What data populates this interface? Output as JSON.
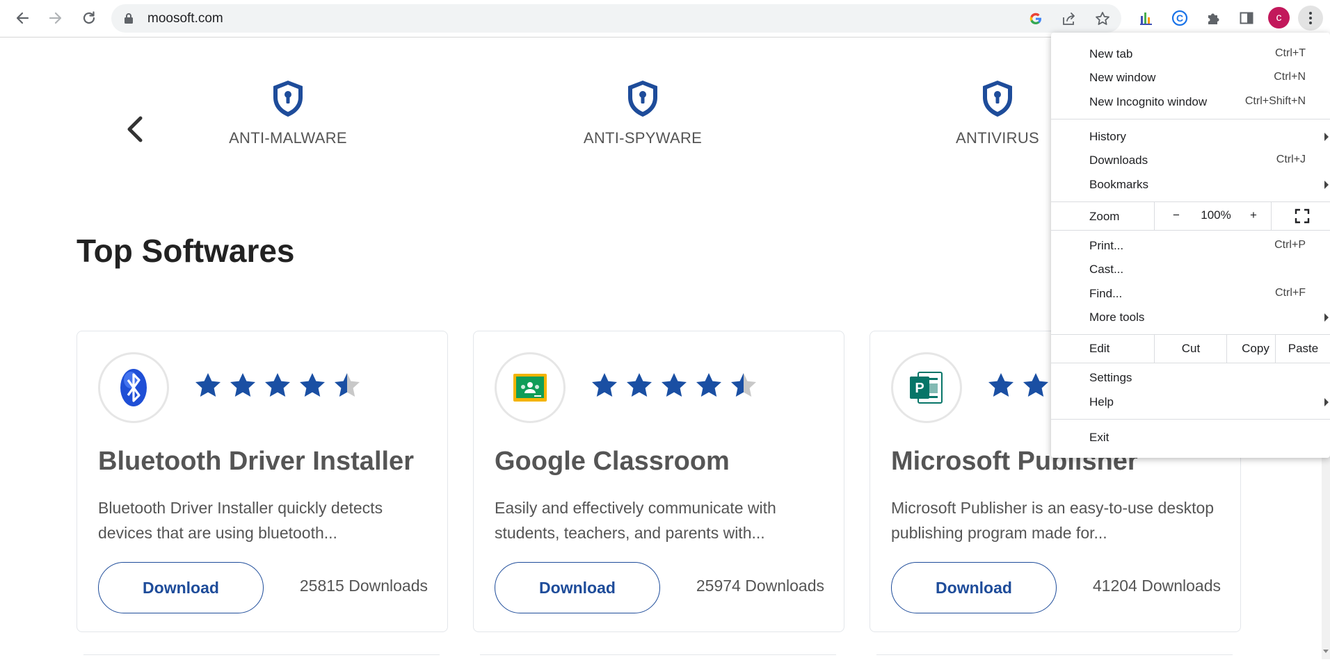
{
  "browser": {
    "url": "moosoft.com",
    "avatar_letter": "c",
    "avatar_color": "#c2185b"
  },
  "categories": [
    {
      "label": "ANTI-MALWARE",
      "icon": "shield-keyhole-icon"
    },
    {
      "label": "ANTI-SPYWARE",
      "icon": "shield-keyhole-icon"
    },
    {
      "label": "ANTIVIRUS",
      "icon": "shield-keyhole-icon"
    }
  ],
  "section_title": "Top Softwares",
  "cards": [
    {
      "name": "Bluetooth Driver Installer",
      "description": "Bluetooth Driver Installer quickly detects devices that are using bluetooth...",
      "download_label": "Download",
      "downloads": "25815 Downloads",
      "rating": 4.5,
      "icon": "bluetooth-icon"
    },
    {
      "name": "Google Classroom",
      "description": "Easily and effectively communicate with students, teachers, and parents with...",
      "download_label": "Download",
      "downloads": "25974 Downloads",
      "rating": 4.5,
      "icon": "google-classroom-icon"
    },
    {
      "name": "Microsoft Publisher",
      "description": "Microsoft Publisher is an easy-to-use desktop publishing program made for...",
      "download_label": "Download",
      "downloads": "41204 Downloads",
      "rating": 4.5,
      "icon": "publisher-icon"
    }
  ],
  "menu": {
    "new_tab": {
      "label": "New tab",
      "shortcut": "Ctrl+T"
    },
    "new_window": {
      "label": "New window",
      "shortcut": "Ctrl+N"
    },
    "new_incognito": {
      "label": "New Incognito window",
      "shortcut": "Ctrl+Shift+N"
    },
    "history": {
      "label": "History"
    },
    "downloads": {
      "label": "Downloads",
      "shortcut": "Ctrl+J"
    },
    "bookmarks": {
      "label": "Bookmarks"
    },
    "zoom": {
      "label": "Zoom",
      "minus": "−",
      "value": "100%",
      "plus": "+"
    },
    "print": {
      "label": "Print...",
      "shortcut": "Ctrl+P"
    },
    "cast": {
      "label": "Cast..."
    },
    "find": {
      "label": "Find...",
      "shortcut": "Ctrl+F"
    },
    "more_tools": {
      "label": "More tools"
    },
    "edit": {
      "label": "Edit",
      "cut": "Cut",
      "copy": "Copy",
      "paste": "Paste"
    },
    "settings": {
      "label": "Settings"
    },
    "help": {
      "label": "Help"
    },
    "exit": {
      "label": "Exit"
    }
  },
  "colors": {
    "brand_blue": "#1e4c9a",
    "star_blue": "#1a4fa3"
  }
}
